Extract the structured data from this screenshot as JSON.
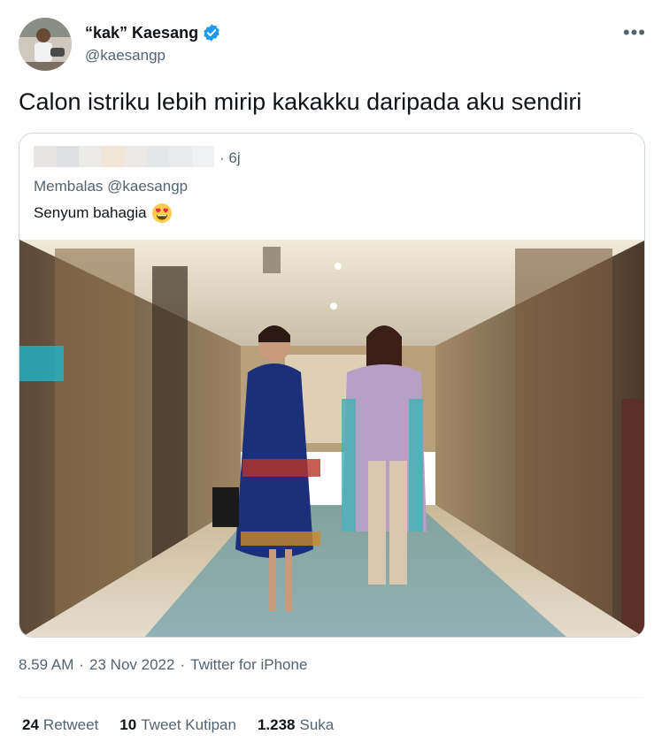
{
  "author": {
    "display_name": "“kak” Kaesang",
    "handle": "@kaesangp",
    "verified_icon": "verified-badge-icon",
    "more_icon": "more-options-icon"
  },
  "tweet": {
    "text": "Calon istriku lebih mirip kakakku daripada aku sendiri",
    "time": "8.59 AM",
    "date": "23 Nov 2022",
    "source": "Twitter for iPhone",
    "sep": "·"
  },
  "quoted": {
    "time": "· 6j",
    "reply_to": "Membalas @kaesangp",
    "text": "Senyum bahagia",
    "emoji_icon": "heart-eyes-emoji-icon"
  },
  "stats": [
    {
      "count": "24",
      "label": "Retweet"
    },
    {
      "count": "10",
      "label": "Tweet Kutipan"
    },
    {
      "count": "1.238",
      "label": "Suka"
    }
  ],
  "colors": {
    "accent": "#1d9bf0",
    "text_primary": "#0f1419",
    "text_secondary": "#536471",
    "border": "#cfd9de"
  }
}
